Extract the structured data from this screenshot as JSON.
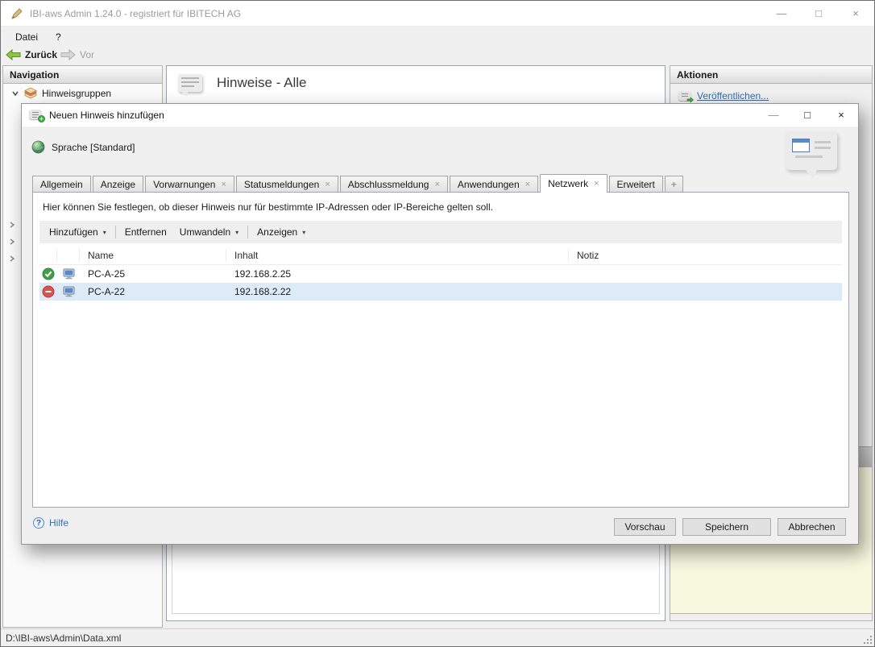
{
  "window": {
    "title": "IBI-aws Admin 1.24.0 - registriert für IBITECH AG"
  },
  "icons": {
    "minimize": "—",
    "maximize": "□",
    "close": "×",
    "caret": "▾",
    "tab_close": "×"
  },
  "menu": {
    "items": [
      "Datei",
      "?"
    ]
  },
  "toolbar": {
    "back": "Zurück",
    "forward": "Vor"
  },
  "navigation": {
    "header": "Navigation",
    "items": [
      {
        "label": "Hinweisgruppen",
        "expanded": true
      }
    ]
  },
  "main": {
    "title": "Hinweise - Alle"
  },
  "actions": {
    "header": "Aktionen",
    "publish_label": "Veröffentlichen..."
  },
  "dialog": {
    "title": "Neuen Hinweis hinzufügen",
    "language_label": "Sprache [Standard]",
    "tabs": [
      {
        "label": "Allgemein",
        "closable": false,
        "active": false
      },
      {
        "label": "Anzeige",
        "closable": false,
        "active": false
      },
      {
        "label": "Vorwarnungen",
        "closable": true,
        "active": false
      },
      {
        "label": "Statusmeldungen",
        "closable": true,
        "active": false
      },
      {
        "label": "Abschlussmeldung",
        "closable": true,
        "active": false
      },
      {
        "label": "Anwendungen",
        "closable": true,
        "active": false
      },
      {
        "label": "Netzwerk",
        "closable": true,
        "active": true
      },
      {
        "label": "Erweitert",
        "closable": false,
        "active": false
      },
      {
        "label": "+",
        "closable": false,
        "active": false,
        "add": true
      }
    ],
    "description": "Hier können Sie festlegen, ob dieser Hinweis nur für bestimmte IP-Adressen oder IP-Bereiche gelten soll.",
    "table_toolbar": {
      "add": "Hinzufügen",
      "remove": "Entfernen",
      "convert": "Umwandeln",
      "show": "Anzeigen"
    },
    "table": {
      "columns": [
        "Name",
        "Inhalt",
        "Notiz"
      ],
      "rows": [
        {
          "status": "allowed",
          "name": "PC-A-25",
          "content": "192.168.2.25",
          "note": "",
          "selected": false
        },
        {
          "status": "denied",
          "name": "PC-A-22",
          "content": "192.168.2.22",
          "note": "",
          "selected": true
        }
      ]
    },
    "footer": {
      "help": "Hilfe",
      "preview": "Vorschau",
      "save": "Speichern",
      "cancel": "Abbrechen"
    }
  },
  "statusbar": {
    "path": "D:\\IBI-aws\\Admin\\Data.xml"
  },
  "colors": {
    "link": "#2f6fb5",
    "selected_row": "#dcebf7",
    "allowed": "#43a047",
    "denied": "#d9534f",
    "note_bg": "#f8f8df"
  }
}
